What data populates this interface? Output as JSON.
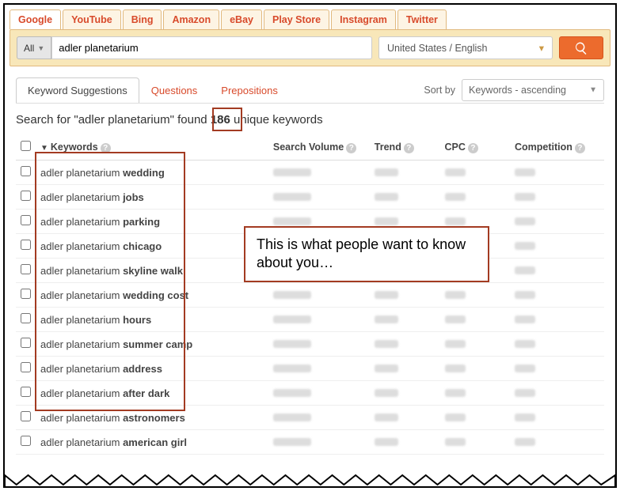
{
  "source_tabs": [
    "Google",
    "YouTube",
    "Bing",
    "Amazon",
    "eBay",
    "Play Store",
    "Instagram",
    "Twitter"
  ],
  "active_source_tab": "Google",
  "scope_selector": "All",
  "search_value": "adler planetarium",
  "locale": "United States / English",
  "mid_tabs": {
    "active": "Keyword Suggestions",
    "t1": "Questions",
    "t2": "Prepositions"
  },
  "sort": {
    "label": "Sort by",
    "value": "Keywords - ascending"
  },
  "result_summary": {
    "prefix": "Search for \"",
    "term": "adler planetarium",
    "middle": "\" found ",
    "count": "186",
    "suffix": " unique keywords"
  },
  "columns": {
    "kw": "Keywords",
    "sv": "Search Volume",
    "tr": "Trend",
    "cpc": "CPC",
    "cmp": "Competition"
  },
  "rows": [
    {
      "base": "adler planetarium ",
      "bold": "wedding"
    },
    {
      "base": "adler planetarium ",
      "bold": "jobs"
    },
    {
      "base": "adler planetarium ",
      "bold": "parking"
    },
    {
      "base": "adler planetarium ",
      "bold": "chicago"
    },
    {
      "base": "adler planetarium ",
      "bold": "skyline walk"
    },
    {
      "base": "adler planetarium ",
      "bold": "wedding cost"
    },
    {
      "base": "adler planetarium ",
      "bold": "hours"
    },
    {
      "base": "adler planetarium ",
      "bold": "summer camp"
    },
    {
      "base": "adler planetarium ",
      "bold": "address"
    },
    {
      "base": "adler planetarium ",
      "bold": "after dark"
    },
    {
      "base": "adler planetarium ",
      "bold": "astronomers"
    },
    {
      "base": "adler planetarium ",
      "bold": "american girl"
    }
  ],
  "annotation_text": "This is what people want to know about you…"
}
